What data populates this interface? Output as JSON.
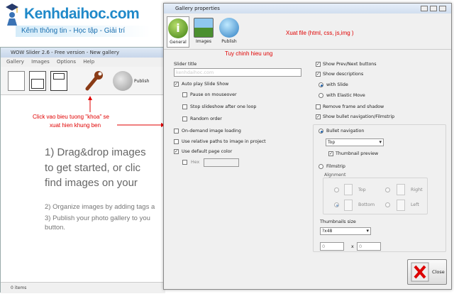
{
  "logo": {
    "title": "Kenhdaihoc.com",
    "subtitle": "Kênh thông tin - Học tập - Giải trí"
  },
  "back_window": {
    "title": "WOW Slider 2.6 - Free version - New gallery",
    "menu": [
      "Gallery",
      "Images",
      "Options",
      "Help"
    ],
    "publish_label": "Publish",
    "instructions": [
      "1) Drag&drop images",
      "to get started, or clic",
      "find images on your"
    ],
    "step2": "2) Organize images by adding tags a",
    "step3a": "3) Publish your photo gallery to you",
    "step3b": "button.",
    "status": "0 items"
  },
  "annotations": {
    "click_icon": "Click vao bieu tuong \"khoa\" se",
    "click_icon2": "xuat hien khung ben",
    "tuy_chinh": "Tuy chinh hieu ung",
    "xuat_file": "Xuat file (html, css, js,img )"
  },
  "dialog": {
    "title": "Gallery properties",
    "tabs": [
      "General",
      "Images",
      "Publish"
    ],
    "slider_title_label": "Slider title",
    "slider_title_value": "kenhdaihoc.com",
    "auto_play": "Auto play Slide Show",
    "pause_mouseover": "Pause on mouseover",
    "stop_after_loop": "Stop slideshow after one loop",
    "random_order": "Random order",
    "on_demand": "On-demand image loading",
    "relative_paths": "Use relative paths to image in project",
    "default_color": "Use default page color",
    "hex_label": "Hex",
    "show_prevnext": "Show Prev/Next buttons",
    "show_desc": "Show descriptions",
    "with_slide": "with Slide",
    "with_elastic": "with Elastic Move",
    "remove_frame": "Remove frame and shadow",
    "show_bullet": "Show bullet navigation/Filmstrip",
    "bullet_nav": "Bullet navigation",
    "bullet_pos": "Top",
    "thumb_preview": "Thumbnail preview",
    "filmstrip": "Filmstrip",
    "alignment_label": "Algnment",
    "align_top": "Top",
    "align_right": "Right",
    "align_bottom": "Bottom",
    "align_left": "Left",
    "thumb_size_label": "Thumbnails size",
    "thumb_size_value": "?x48",
    "thumb_w": "0",
    "thumb_x": "x",
    "thumb_h": "0",
    "close_label": "Close"
  },
  "colors": {
    "accent_red": "#e00000",
    "logo_blue": "#1f89c9"
  }
}
